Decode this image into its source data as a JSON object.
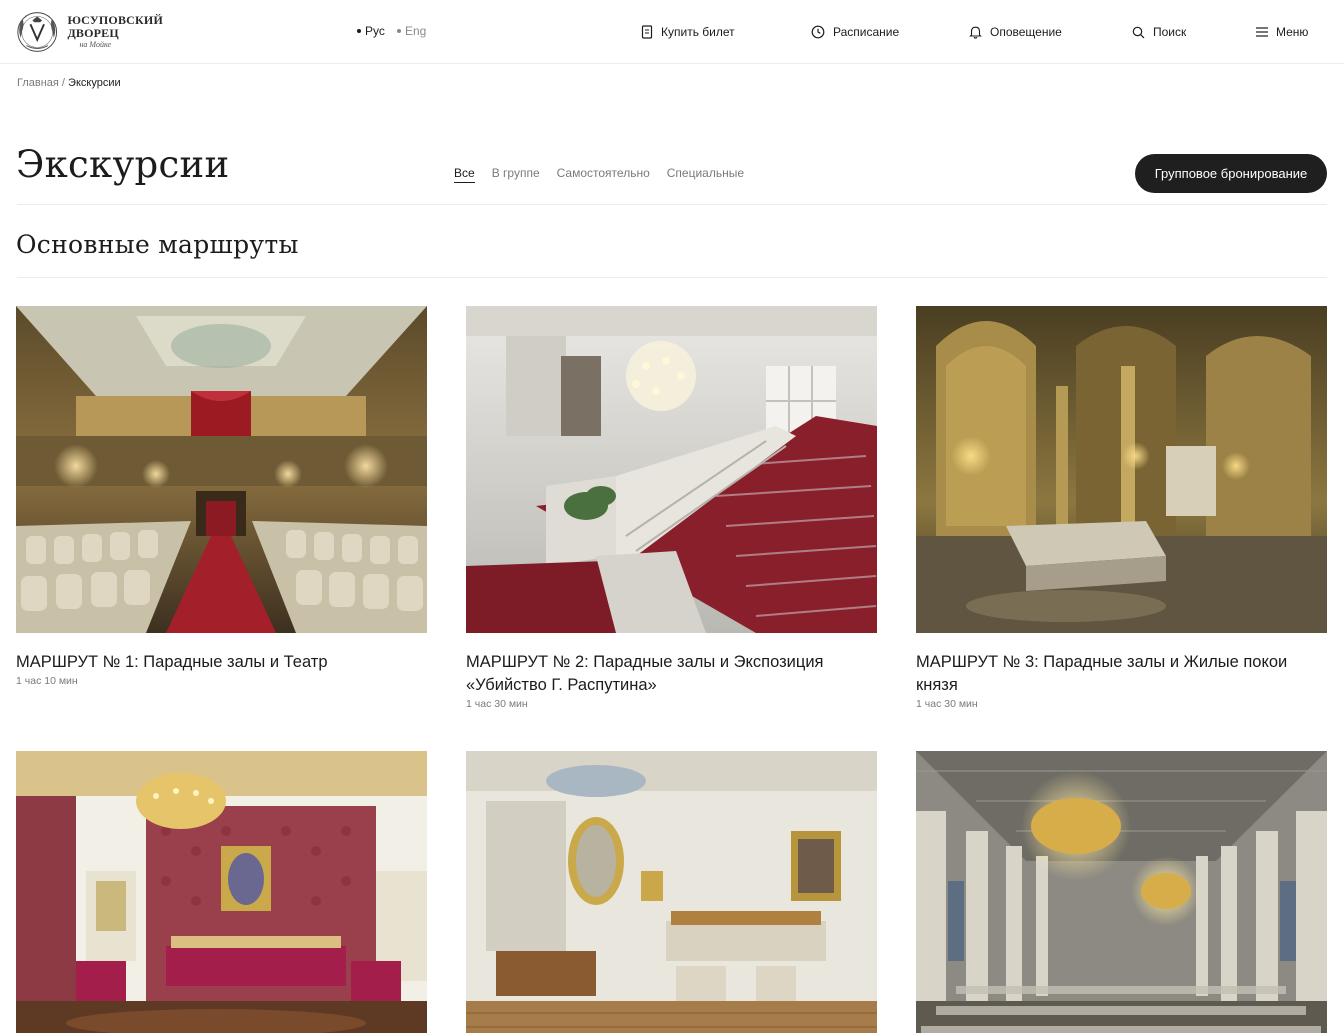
{
  "header": {
    "logo": {
      "line1": "ЮСУПОВСКИЙ",
      "line2": "ДВОРЕЦ",
      "line3": "на Мойке"
    },
    "lang": {
      "ru": "Рус",
      "en": "Eng"
    },
    "nav": {
      "ticket": "Купить билет",
      "schedule": "Расписание",
      "notify": "Оповещение",
      "search": "Поиск",
      "menu": "Меню"
    }
  },
  "breadcrumb": {
    "home": "Главная",
    "separator": " / ",
    "current": "Экскурсии"
  },
  "page": {
    "title": "Экскурсии",
    "tabs": [
      "Все",
      "В группе",
      "Самостоятельно",
      "Специальные"
    ],
    "active_tab": "Все",
    "group_booking": "Групповое бронирование"
  },
  "section": {
    "title": "Основные маршруты"
  },
  "cards": [
    {
      "title": "МАРШРУТ № 1: Парадные залы и Театр",
      "duration": "1 час 10 мин"
    },
    {
      "title": "МАРШРУТ № 2: Парадные залы и Экспозиция «Убийство Г. Распутина»",
      "duration": "1 час 30 мин"
    },
    {
      "title": "МАРШРУТ № 3: Парадные залы и Жилые покои князя",
      "duration": "1 час 30 мин"
    },
    {
      "title": "",
      "duration": ""
    },
    {
      "title": "",
      "duration": ""
    },
    {
      "title": "",
      "duration": ""
    }
  ],
  "colors": {
    "text": "#1c1c1c",
    "muted": "#7a7a7a",
    "button": "#1f1f1f",
    "divider": "#ececec"
  }
}
